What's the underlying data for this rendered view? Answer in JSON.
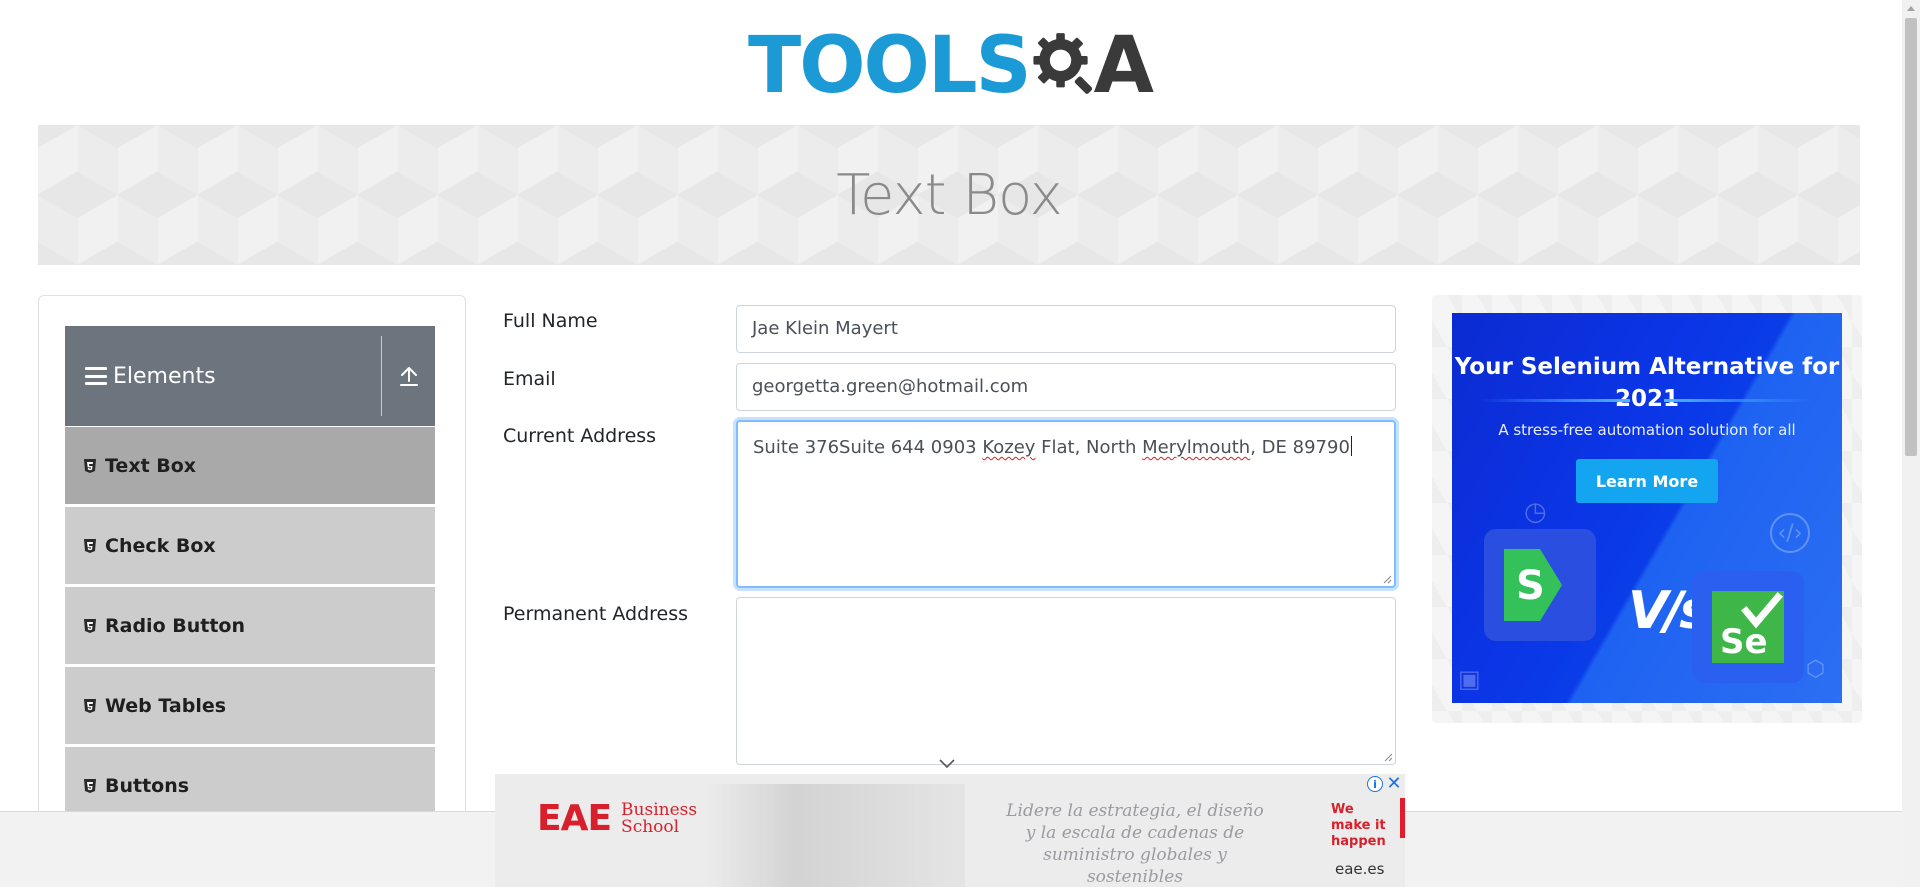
{
  "logo": {
    "text_tools": "TOOLS",
    "text_a": "A"
  },
  "banner": {
    "title": "Text Box"
  },
  "sidebar": {
    "group_title": "Elements",
    "items": [
      {
        "label": "Text Box",
        "active": true
      },
      {
        "label": "Check Box",
        "active": false
      },
      {
        "label": "Radio Button",
        "active": false
      },
      {
        "label": "Web Tables",
        "active": false
      },
      {
        "label": "Buttons",
        "active": false
      }
    ]
  },
  "form": {
    "full_name_label": "Full Name",
    "full_name_value": "Jae Klein Mayert",
    "email_label": "Email",
    "email_value": "georgetta.green@hotmail.com",
    "current_address_label": "Current Address",
    "current_address_parts": [
      "Suite 376Suite 644 0903 ",
      "Kozey",
      " Flat, North ",
      "Merylmouth",
      ", DE 89790"
    ],
    "permanent_address_label": "Permanent Address",
    "permanent_address_value": ""
  },
  "side_ad": {
    "title": "Your Selenium Alternative for 2021",
    "subtitle": "A stress-free automation solution for all",
    "button_label": "Learn More",
    "vs_text": "V/s",
    "left_logo": "S",
    "right_logo": "Se"
  },
  "bottom_ad": {
    "brand_mark": "EAE",
    "brand_name_line1": "Business",
    "brand_name_line2": "School",
    "tagline": "Lidere la estrategia, el diseño y la escala de cadenas de suministro globales y sostenibles",
    "cta": "We make it happen",
    "domain": "eae.es",
    "info_glyph": "i",
    "close_glyph": "✕"
  },
  "colors": {
    "brand_blue": "#1b9ad6",
    "sidebar_header": "#6c757d",
    "menu_item": "#cccccc",
    "menu_item_active": "#a9a9a9",
    "focus_border": "#80bdff",
    "ad_blue": "#0b35e6",
    "ad_button": "#13a5ef",
    "eae_red": "#d8202c"
  },
  "icons": {
    "menu": "hamburger-icon",
    "collapse": "upload-arrow-icon",
    "item": "html5-icon",
    "scroll_hint": "chevron-down-icon"
  }
}
